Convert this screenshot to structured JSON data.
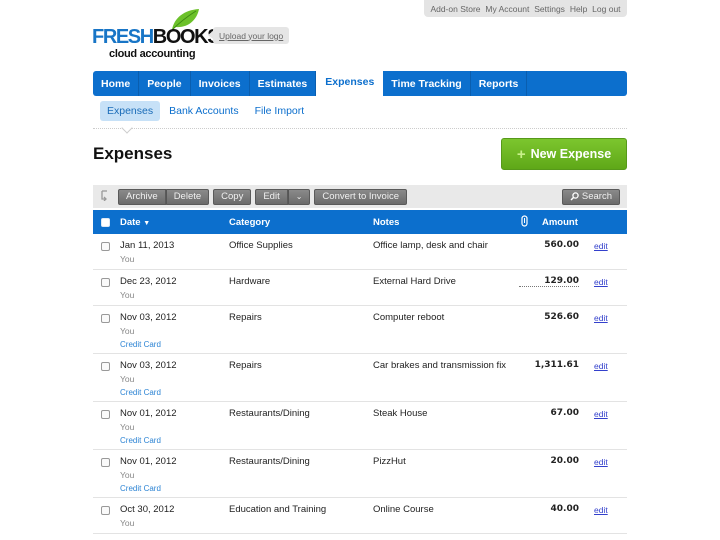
{
  "utility_nav": [
    "Add-on Store",
    "My Account",
    "Settings",
    "Help",
    "Log out"
  ],
  "logo": {
    "brand_part1": "FRESH",
    "brand_part2": "BOOKS",
    "tagline": "cloud accounting",
    "upload_link": "Upload your logo"
  },
  "main_nav": {
    "tabs": [
      {
        "label": "Home",
        "active": false
      },
      {
        "label": "People",
        "active": false
      },
      {
        "label": "Invoices",
        "active": false
      },
      {
        "label": "Estimates",
        "active": false
      },
      {
        "label": "Expenses",
        "active": true
      },
      {
        "label": "Time Tracking",
        "active": false
      },
      {
        "label": "Reports",
        "active": false
      }
    ]
  },
  "sub_nav": {
    "tabs": [
      {
        "label": "Expenses",
        "active": true
      },
      {
        "label": "Bank Accounts",
        "active": false
      },
      {
        "label": "File Import",
        "active": false
      }
    ]
  },
  "page": {
    "title": "Expenses",
    "new_button": "New Expense",
    "new_button_icon": "plus-icon"
  },
  "toolbar": {
    "archive": "Archive",
    "delete": "Delete",
    "copy": "Copy",
    "edit": "Edit",
    "edit_dropdown_icon": "chevron-down-icon",
    "convert": "Convert to Invoice",
    "search": "Search",
    "search_icon": "search-icon"
  },
  "table": {
    "columns": {
      "date": "Date",
      "date_sort_indicator": "▼",
      "category": "Category",
      "notes": "Notes",
      "attachment_icon": "paperclip-icon",
      "amount": "Amount"
    },
    "rows": [
      {
        "date": "Jan 11, 2013",
        "who": "You",
        "account": "",
        "category": "Office Supplies",
        "notes": "Office lamp, desk and chair",
        "amount": "560.00",
        "edit": "edit"
      },
      {
        "date": "Dec 23, 2012",
        "who": "You",
        "account": "",
        "category": "Hardware",
        "notes": "External Hard Drive",
        "amount": "129.00",
        "edit": "edit"
      },
      {
        "date": "Nov 03, 2012",
        "who": "You",
        "account": "Credit Card",
        "category": "Repairs",
        "notes": "Computer reboot",
        "amount": "526.60",
        "edit": "edit"
      },
      {
        "date": "Nov 03, 2012",
        "who": "You",
        "account": "Credit Card",
        "category": "Repairs",
        "notes": "Car brakes and transmission fix",
        "amount": "1,311.61",
        "edit": "edit"
      },
      {
        "date": "Nov 01, 2012",
        "who": "You",
        "account": "Credit Card",
        "category": "Restaurants/Dining",
        "notes": "Steak House",
        "amount": "67.00",
        "edit": "edit"
      },
      {
        "date": "Nov 01, 2012",
        "who": "You",
        "account": "Credit Card",
        "category": "Restaurants/Dining",
        "notes": "PizzHut",
        "amount": "20.00",
        "edit": "edit"
      },
      {
        "date": "Oct 30, 2012",
        "who": "You",
        "account": "",
        "category": "Education and Training",
        "notes": "Online Course",
        "amount": "40.00",
        "edit": "edit"
      }
    ]
  },
  "colors": {
    "brand_blue": "#0c6fcd",
    "action_green": "#6bb823",
    "link_blue": "#3340cc"
  }
}
